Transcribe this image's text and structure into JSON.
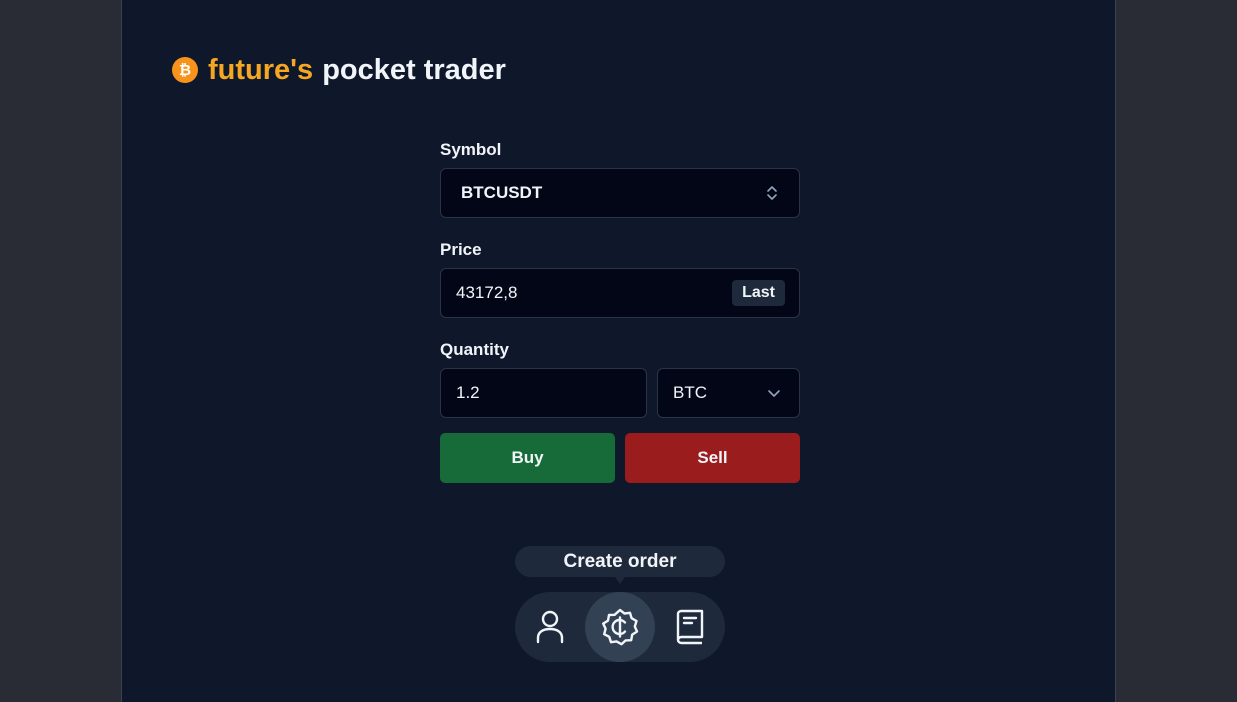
{
  "header": {
    "brand": "future's",
    "title_rest": "pocket trader",
    "logo_icon": "bitcoin-icon",
    "brand_color": "#f5a623"
  },
  "form": {
    "symbol_label": "Symbol",
    "symbol_value": "BTCUSDT",
    "price_label": "Price",
    "price_value": "43172,8",
    "last_button": "Last",
    "quantity_label": "Quantity",
    "quantity_value": "1.2",
    "quantity_unit": "BTC",
    "buy_label": "Buy",
    "sell_label": "Sell",
    "buy_color": "#176b39",
    "sell_color": "#9b1c1c"
  },
  "nav": {
    "tooltip": "Create order",
    "items": [
      {
        "icon": "user-icon",
        "active": false
      },
      {
        "icon": "coin-badge-icon",
        "active": true
      },
      {
        "icon": "book-icon",
        "active": false
      }
    ]
  }
}
